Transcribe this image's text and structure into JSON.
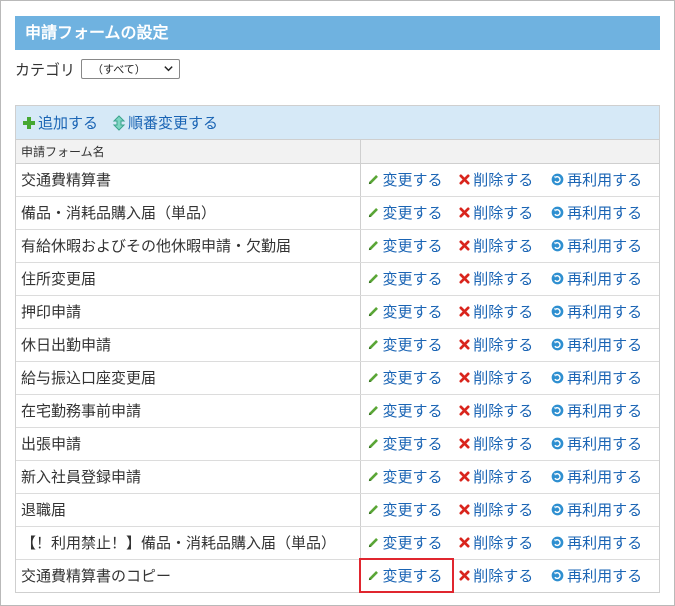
{
  "title": "申請フォームの設定",
  "category": {
    "label": "カテゴリ",
    "selected": "（すべて）"
  },
  "toolbar": {
    "add_label": "追加する",
    "reorder_label": "順番変更する"
  },
  "table": {
    "header_name": "申請フォーム名",
    "action_labels": {
      "edit": "変更する",
      "delete": "削除する",
      "reuse": "再利用する"
    },
    "rows": [
      {
        "name": "交通費精算書"
      },
      {
        "name": "備品・消耗品購入届（単品）"
      },
      {
        "name": "有給休暇およびその他休暇申請・欠勤届"
      },
      {
        "name": "住所変更届"
      },
      {
        "name": "押印申請"
      },
      {
        "name": "休日出勤申請"
      },
      {
        "name": "給与振込口座変更届"
      },
      {
        "name": "在宅勤務事前申請"
      },
      {
        "name": "出張申請"
      },
      {
        "name": "新入社員登録申請"
      },
      {
        "name": "退職届"
      },
      {
        "name": "【！利用禁止！】備品・消耗品購入届（単品）"
      },
      {
        "name": "交通費精算書のコピー"
      }
    ]
  },
  "colors": {
    "title_bar": "#6fb2e0",
    "toolbar_bg": "#d6e9f7",
    "link": "#1a64b4",
    "highlight": "#e0262f"
  }
}
